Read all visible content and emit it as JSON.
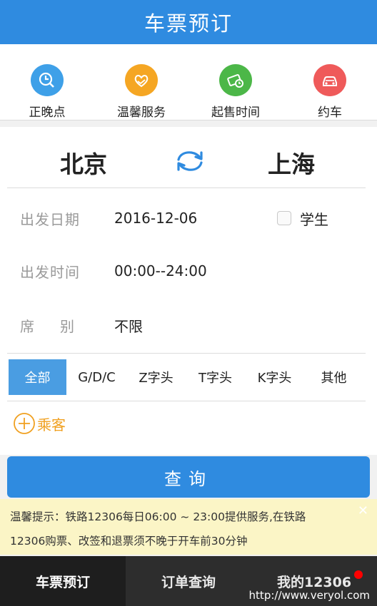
{
  "header": {
    "title": "车票预订"
  },
  "quick_actions": [
    {
      "label": "正晚点",
      "icon": "clock-search-icon",
      "color": "#3ea0e8"
    },
    {
      "label": "温馨服务",
      "icon": "heart-hand-icon",
      "color": "#f5a623"
    },
    {
      "label": "起售时间",
      "icon": "ticket-clock-icon",
      "color": "#4cb748"
    },
    {
      "label": "约车",
      "icon": "car-icon",
      "color": "#ef5a5a"
    }
  ],
  "stations": {
    "from": "北京",
    "to": "上海"
  },
  "form": {
    "date_label": "出发日期",
    "date_value": "2016-12-06",
    "student_label": "学生",
    "time_label": "出发时间",
    "time_value": "00:00--24:00",
    "seat_label_a": "席",
    "seat_label_b": "别",
    "seat_value": "不限"
  },
  "train_types": [
    {
      "label": "全部",
      "active": true
    },
    {
      "label": "G/D/C",
      "active": false
    },
    {
      "label": "Z字头",
      "active": false
    },
    {
      "label": "T字头",
      "active": false
    },
    {
      "label": "K字头",
      "active": false
    },
    {
      "label": "其他",
      "active": false
    }
  ],
  "passenger": {
    "label": "乘客"
  },
  "query_button": "查询",
  "notice": {
    "line1": "温馨提示：铁路12306每日06:00 ~ 23:00提供服务,在铁路",
    "line2": "12306购票、改签和退票须不晚于开车前30分钟"
  },
  "bottom_nav": [
    {
      "label": "车票预订",
      "active": true
    },
    {
      "label": "订单查询",
      "active": false
    },
    {
      "label": "我的12306",
      "active": false,
      "badge": true
    }
  ],
  "watermark": "http://www.veryol.com",
  "colors": {
    "primary": "#2f8be0",
    "active_tab": "#4a9de2",
    "passenger": "#f0a020",
    "notice_bg": "#fbf5c6"
  }
}
